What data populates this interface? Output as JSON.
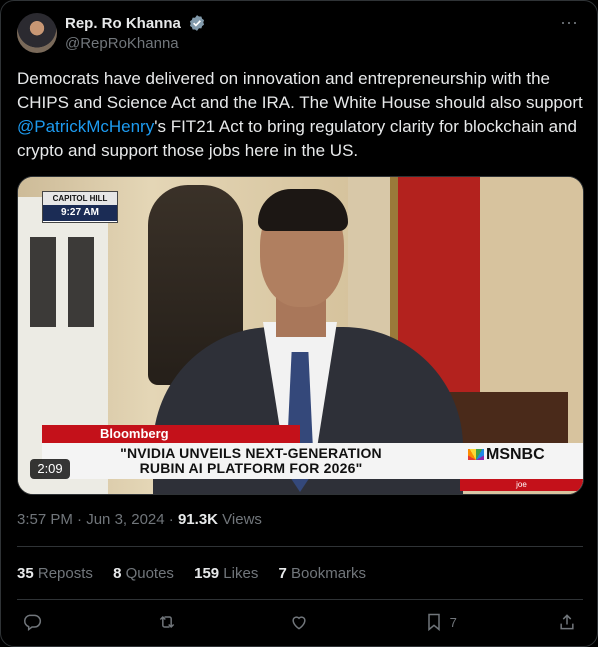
{
  "author": {
    "display_name": "Rep. Ro Khanna",
    "handle": "@RepRoKhanna",
    "verified_icon": "verified-badge-icon"
  },
  "tweet": {
    "text_before": "Democrats have delivered on innovation and entrepreneurship with the CHIPS and Science Act and the IRA. The White House should also support ",
    "mention": "@PatrickMcHenry",
    "text_after": "'s FIT21 Act to bring regulatory clarity for blockchain and crypto and support those jobs here in the US."
  },
  "media": {
    "location_tag": "CAPITOL HILL",
    "time_tag": "9:27 AM",
    "source_tag": "Bloomberg",
    "headline_line1": "\"NVIDIA UNVEILS NEXT-GENERATION",
    "headline_line2": "RUBIN AI PLATFORM FOR 2026\"",
    "network": "MSNBC",
    "show": "joe",
    "duration": "2:09"
  },
  "meta": {
    "time": "3:57 PM",
    "separator": " · ",
    "date": "Jun 3, 2024",
    "views_count": "91.3K",
    "views_label": " Views"
  },
  "stats": {
    "reposts_count": "35",
    "reposts_label": " Reposts",
    "quotes_count": "8",
    "quotes_label": " Quotes",
    "likes_count": "159",
    "likes_label": " Likes",
    "bookmarks_count": "7",
    "bookmarks_label": " Bookmarks"
  },
  "actions": {
    "bookmark_count": "7"
  },
  "colors": {
    "accent": "#1d9bf0",
    "background": "#000000",
    "muted": "#71767b",
    "text": "#e7e9ea"
  }
}
